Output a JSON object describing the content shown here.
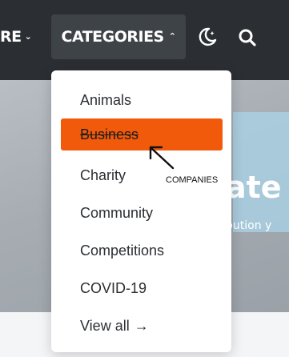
{
  "nav": {
    "explore_label": "RE",
    "categories_label": "CATEGORIES",
    "moon_icon": "moon-icon",
    "search_icon": "search-icon"
  },
  "hero": {
    "heading": "ate",
    "subtitle": "bution y"
  },
  "dropdown": {
    "items": [
      {
        "label": "Animals"
      },
      {
        "label": "Business"
      },
      {
        "label": "Charity"
      },
      {
        "label": "Community"
      },
      {
        "label": "Competitions"
      },
      {
        "label": "COVID-19"
      },
      {
        "label": "View all"
      }
    ]
  },
  "annotation": {
    "label": "COMPANIES"
  },
  "colors": {
    "navbar": "#2b2f34",
    "active_item": "#f25a0b"
  }
}
